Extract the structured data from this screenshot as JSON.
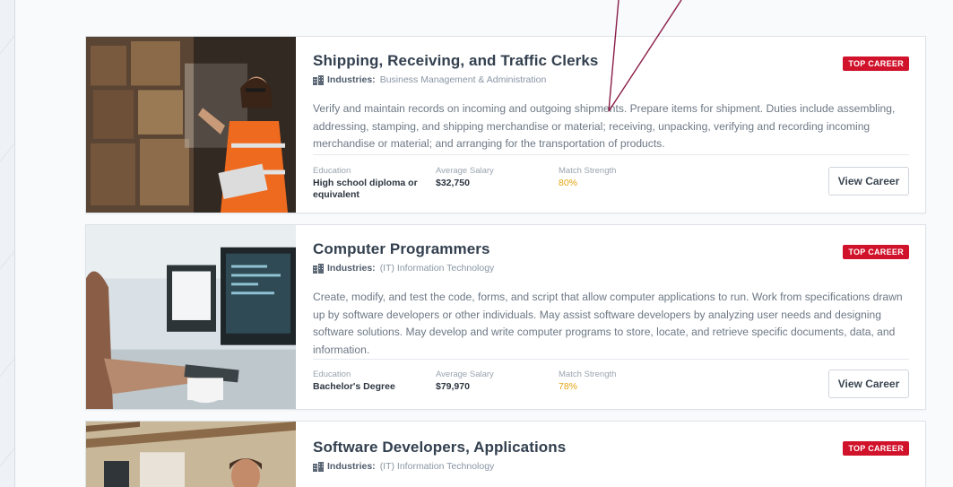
{
  "careers": [
    {
      "title": "Shipping, Receiving, and Traffic Clerks",
      "industries_label": "Industries:",
      "industries_value": "Business Management & Administration",
      "badge": "TOP CAREER",
      "description": "Verify and maintain records on incoming and outgoing shipments. Prepare items for shipment. Duties include assembling, addressing, stamping, and shipping merchandise or material; receiving, unpacking, verifying and recording incoming merchandise or material; and arranging for the transportation of products.",
      "education_label": "Education",
      "education_value": "High school diploma or equivalent",
      "salary_label": "Average Salary",
      "salary_value": "$32,750",
      "match_label": "Match Strength",
      "match_value": "80%",
      "button": "View Career"
    },
    {
      "title": "Computer Programmers",
      "industries_label": "Industries:",
      "industries_value": "(IT) Information Technology",
      "badge": "TOP CAREER",
      "description": "Create, modify, and test the code, forms, and script that allow computer applications to run. Work from specifications drawn up by software developers or other individuals. May assist software developers by analyzing user needs and designing software solutions. May develop and write computer programs to store, locate, and retrieve specific documents, data, and information.",
      "education_label": "Education",
      "education_value": "Bachelor's Degree",
      "salary_label": "Average Salary",
      "salary_value": "$79,970",
      "match_label": "Match Strength",
      "match_value": "78%",
      "button": "View Career"
    },
    {
      "title": "Software Developers, Applications",
      "industries_label": "Industries:",
      "industries_value": "(IT) Information Technology",
      "badge": "TOP CAREER"
    }
  ],
  "colors": {
    "badge": "#d0122a",
    "match": "#e5a412",
    "callout": "#8a1c47"
  }
}
